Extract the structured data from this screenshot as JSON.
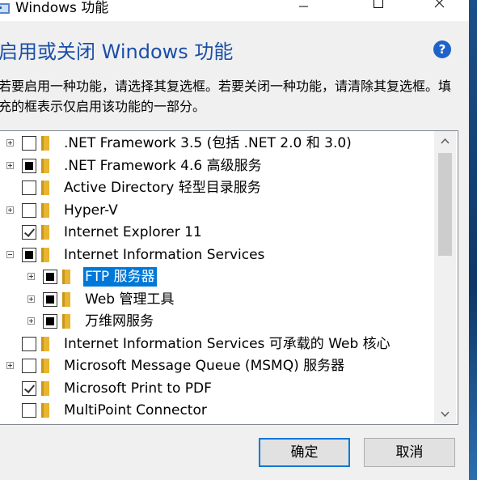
{
  "window": {
    "title": "Windows 功能",
    "controls": {
      "minimize": "—",
      "maximize": "☐",
      "close": "✕"
    }
  },
  "header": {
    "heading": "启用或关闭 Windows 功能",
    "help_icon": "?",
    "description": "若要启用一种功能，请选择其复选框。若要关闭一种功能，请清除其复选框。填充的框表示仅启用该功能的一部分。"
  },
  "features": [
    {
      "label": ".NET Framework 3.5 (包括 .NET 2.0 和 3.0)",
      "state": "unchecked",
      "expander": "plus",
      "level": 0
    },
    {
      "label": ".NET Framework 4.6 高级服务",
      "state": "partial",
      "expander": "plus",
      "level": 0
    },
    {
      "label": "Active Directory 轻型目录服务",
      "state": "unchecked",
      "expander": "none",
      "level": 0
    },
    {
      "label": "Hyper-V",
      "state": "unchecked",
      "expander": "plus",
      "level": 0
    },
    {
      "label": "Internet Explorer 11",
      "state": "checked",
      "expander": "none",
      "level": 0
    },
    {
      "label": "Internet Information Services",
      "state": "partial",
      "expander": "minus",
      "level": 0
    },
    {
      "label": "FTP 服务器",
      "state": "partial",
      "expander": "plus",
      "level": 1,
      "selected": true
    },
    {
      "label": "Web 管理工具",
      "state": "partial",
      "expander": "plus",
      "level": 1
    },
    {
      "label": "万维网服务",
      "state": "partial",
      "expander": "plus",
      "level": 1
    },
    {
      "label": "Internet Information Services 可承载的 Web 核心",
      "state": "unchecked",
      "expander": "none",
      "level": 0
    },
    {
      "label": "Microsoft Message Queue (MSMQ) 服务器",
      "state": "unchecked",
      "expander": "plus",
      "level": 0
    },
    {
      "label": "Microsoft Print to PDF",
      "state": "checked",
      "expander": "none",
      "level": 0
    },
    {
      "label": "MultiPoint Connector",
      "state": "unchecked",
      "expander": "none",
      "level": 0
    },
    {
      "label": "",
      "state": "unchecked",
      "expander": "none",
      "level": 0
    }
  ],
  "scrollbar": {
    "up_arrow": "∧",
    "down_arrow": "∨"
  },
  "buttons": {
    "ok": "确定",
    "cancel": "取消"
  },
  "colors": {
    "heading": "#1a4fa8",
    "selection": "#0078d7",
    "folder": "#e8b530",
    "help": "#1e63c8"
  }
}
